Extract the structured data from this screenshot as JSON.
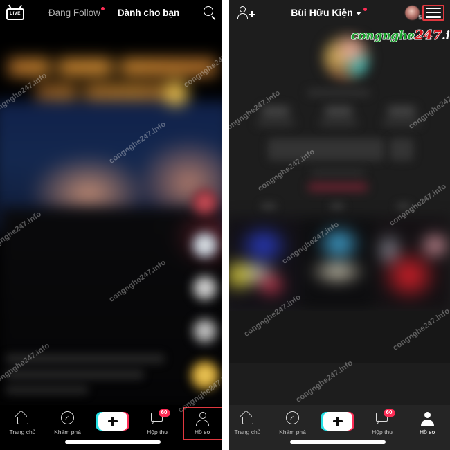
{
  "watermark": {
    "brand_green": "congnghe",
    "brand_red": "247",
    "brand_white": ".info",
    "tile_text": "congnghe247.info",
    "color_green": "#19a02c",
    "color_red": "#d8141d",
    "color_white": "#ffffff"
  },
  "accent": {
    "tiktok_red": "#fe2c55",
    "tiktok_cyan": "#23e0e5",
    "highlight_red": "#e0383f"
  },
  "left_panel": {
    "name": "tiktok-feed-screen",
    "topbar": {
      "live_label": "LIVE",
      "live_icon": "live-tv-icon",
      "tab_following": "Đang Follow",
      "tab_foryou": "Dành cho bạn",
      "search_icon": "search-icon"
    },
    "rail": [
      {
        "name": "author-avatar",
        "icon": "avatar-icon"
      },
      {
        "name": "like",
        "icon": "heart-icon"
      },
      {
        "name": "comment",
        "icon": "comment-icon"
      },
      {
        "name": "share",
        "icon": "share-icon"
      },
      {
        "name": "music",
        "icon": "music-disc-icon"
      }
    ],
    "bottom_nav": [
      {
        "label": "Trang chủ",
        "icon": "home-icon",
        "active": false,
        "highlighted": false
      },
      {
        "label": "Khám phá",
        "icon": "compass-icon",
        "active": false,
        "highlighted": false
      },
      {
        "label": "",
        "icon": "plus-icon",
        "active": false,
        "highlighted": false
      },
      {
        "label": "Hộp thư",
        "icon": "inbox-icon",
        "active": false,
        "highlighted": false,
        "badge": "60"
      },
      {
        "label": "Hồ sơ",
        "icon": "person-icon",
        "active": false,
        "highlighted": true
      }
    ]
  },
  "right_panel": {
    "name": "tiktok-profile-screen",
    "topbar": {
      "add_friend_icon": "add-friend-icon",
      "profile_name": "Bùi Hữu Kiện",
      "chevron_icon": "chevron-down-icon",
      "avatar_icon": "mini-avatar-icon",
      "avatar_count": "5",
      "menu_icon": "hamburger-menu-icon",
      "menu_highlighted": true
    },
    "bottom_nav": [
      {
        "label": "Trang chủ",
        "icon": "home-icon",
        "active": false,
        "highlighted": false
      },
      {
        "label": "Khám phá",
        "icon": "compass-icon",
        "active": false,
        "highlighted": false
      },
      {
        "label": "",
        "icon": "plus-icon",
        "active": false,
        "highlighted": false
      },
      {
        "label": "Hộp thư",
        "icon": "inbox-icon",
        "active": false,
        "highlighted": false,
        "badge": "60"
      },
      {
        "label": "Hồ sơ",
        "icon": "person-icon",
        "active": true,
        "highlighted": false
      }
    ]
  }
}
